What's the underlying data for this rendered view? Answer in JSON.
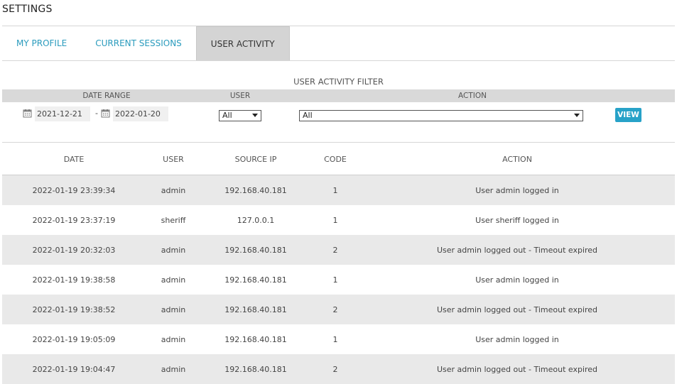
{
  "page": {
    "title": "SETTINGS"
  },
  "tabs": [
    {
      "label": "MY PROFILE",
      "active": false
    },
    {
      "label": "CURRENT SESSIONS",
      "active": false
    },
    {
      "label": "USER ACTIVITY",
      "active": true
    }
  ],
  "filter": {
    "title": "USER ACTIVITY FILTER",
    "headers": {
      "date_range": "DATE RANGE",
      "user": "USER",
      "action": "ACTION"
    },
    "date_from": "2021-12-21",
    "date_separator": "-",
    "date_to": "2022-01-20",
    "user_selected": "All",
    "action_selected": "All",
    "view_label": "VIEW"
  },
  "table": {
    "headers": {
      "date": "DATE",
      "user": "USER",
      "source_ip": "SOURCE IP",
      "code": "CODE",
      "action": "ACTION"
    },
    "rows": [
      {
        "date": "2022-01-19 23:39:34",
        "user": "admin",
        "source_ip": "192.168.40.181",
        "code": "1",
        "action": "User admin logged in"
      },
      {
        "date": "2022-01-19 23:37:19",
        "user": "sheriff",
        "source_ip": "127.0.0.1",
        "code": "1",
        "action": "User sheriff logged in"
      },
      {
        "date": "2022-01-19 20:32:03",
        "user": "admin",
        "source_ip": "192.168.40.181",
        "code": "2",
        "action": "User admin logged out - Timeout expired"
      },
      {
        "date": "2022-01-19 19:38:58",
        "user": "admin",
        "source_ip": "192.168.40.181",
        "code": "1",
        "action": "User admin logged in"
      },
      {
        "date": "2022-01-19 19:38:52",
        "user": "admin",
        "source_ip": "192.168.40.181",
        "code": "2",
        "action": "User admin logged out - Timeout expired"
      },
      {
        "date": "2022-01-19 19:05:09",
        "user": "admin",
        "source_ip": "192.168.40.181",
        "code": "1",
        "action": "User admin logged in"
      },
      {
        "date": "2022-01-19 19:04:47",
        "user": "admin",
        "source_ip": "192.168.40.181",
        "code": "2",
        "action": "User admin logged out - Timeout expired"
      }
    ]
  },
  "colors": {
    "accent": "#27a2c8",
    "tab_link": "#2a9bbd",
    "tab_active_bg": "#d4d4d4",
    "row_alt": "#e9e9e9"
  },
  "icons": {
    "date_picker": "calendar-icon",
    "dropdown": "chevron-down-icon"
  }
}
